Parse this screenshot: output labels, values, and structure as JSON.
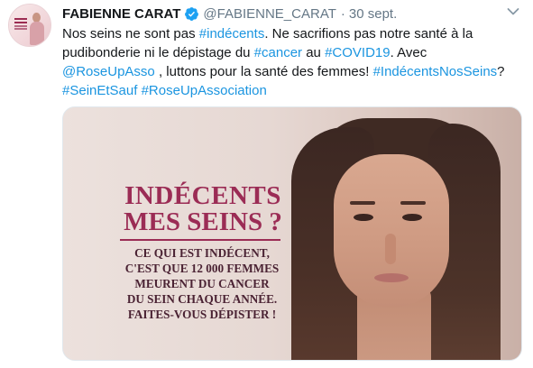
{
  "author": {
    "name": "FABIENNE CARAT",
    "handle": "@FABIENNE_CARAT",
    "separator": "·",
    "date": "30 sept.",
    "verified": true
  },
  "icons": {
    "verified": "verified-badge-icon",
    "menu": "chevron-down-icon"
  },
  "colors": {
    "link": "#1b95e0",
    "verified": "#1da1f2",
    "poster_title": "#9b2c55",
    "poster_body": "#4a2233"
  },
  "text": {
    "line1": {
      "a": "Nos seins ne sont pas ",
      "b": "#indécents",
      "c": ".  Ne sacrifions pas notre santé à la"
    },
    "line2": {
      "a": "pudibonderie ni le dépistage du ",
      "b": "#cancer",
      "c": " au ",
      "d": "#COVID19",
      "e": ". Avec"
    },
    "line3": {
      "a": "@RoseUpAsso",
      "b": " ,  luttons pour la santé des femmes! ",
      "c": "#IndécentsNosSeins",
      "d": "?"
    },
    "line4": {
      "a": "#SeinEtSauf",
      "b": " ",
      "c": "#RoseUpAssociation"
    }
  },
  "media": {
    "title_line1": "INDÉCENTS",
    "title_line2": "MES SEINS ?",
    "body_lines": [
      "CE QUI EST INDÉCENT,",
      "C'EST QUE 12 000 FEMMES",
      "MEURENT DU CANCER",
      "DU SEIN CHAQUE ANNÉE.",
      "FAITES-VOUS DÉPISTER !"
    ]
  }
}
